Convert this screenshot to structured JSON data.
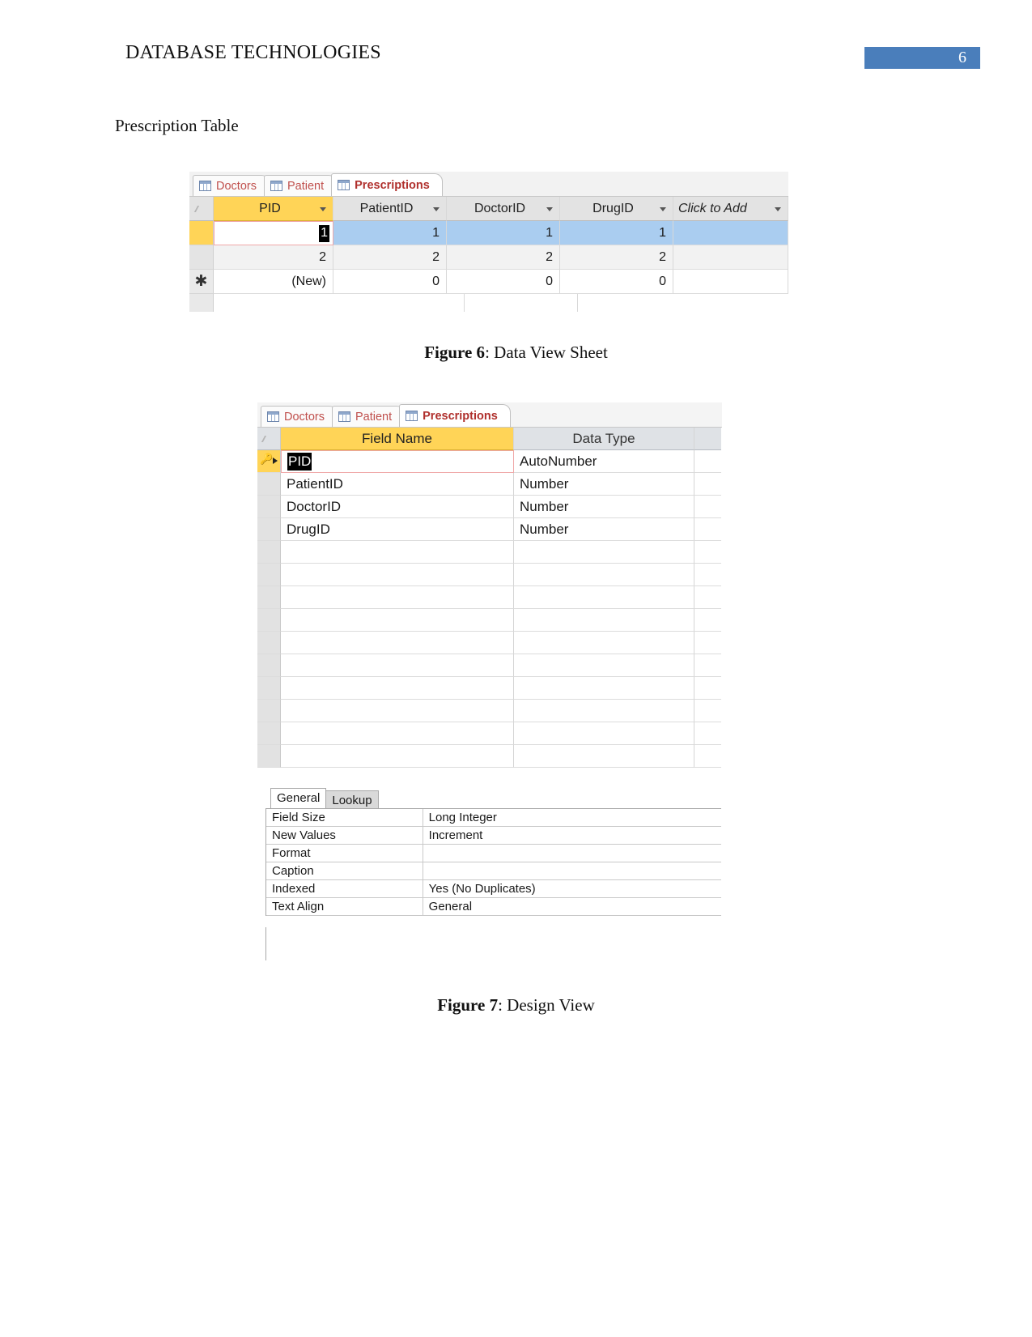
{
  "document": {
    "header_title": "DATABASE TECHNOLOGIES",
    "page_number": "6",
    "page_badge_color": "#4a7ebb",
    "section_text": "Prescription Table"
  },
  "figure6": {
    "caption_label": "Figure 6",
    "caption_text": ": Data View Sheet",
    "tabs": [
      {
        "label": "Doctors",
        "icon": "table-icon",
        "active": false
      },
      {
        "label": "Patient",
        "icon": "table-icon",
        "active": false
      },
      {
        "label": "Prescriptions",
        "icon": "table-icon",
        "active": true
      }
    ],
    "columns": [
      "PID",
      "PatientID",
      "DoctorID",
      "DrugID",
      "Click to Add"
    ],
    "rows": [
      {
        "pid": "1",
        "patient_id": "1",
        "doctor_id": "1",
        "drug_id": "1",
        "state": "selected-editing"
      },
      {
        "pid": "2",
        "patient_id": "2",
        "doctor_id": "2",
        "drug_id": "2",
        "state": "normal"
      },
      {
        "pid": "(New)",
        "patient_id": "0",
        "doctor_id": "0",
        "drug_id": "0",
        "state": "new-record"
      }
    ],
    "new_record_marker": "✱",
    "selected_header": "PID",
    "editing_cell_value": "1"
  },
  "figure7": {
    "caption_label": "Figure 7",
    "caption_text": ": Design View",
    "tabs": [
      {
        "label": "Doctors",
        "icon": "table-icon",
        "active": false
      },
      {
        "label": "Patient",
        "icon": "table-icon",
        "active": false
      },
      {
        "label": "Prescriptions",
        "icon": "table-icon",
        "active": true
      }
    ],
    "columns": [
      "Field Name",
      "Data Type"
    ],
    "fields": [
      {
        "name": "PID",
        "type": "AutoNumber",
        "primary_key": true
      },
      {
        "name": "PatientID",
        "type": "Number",
        "primary_key": false
      },
      {
        "name": "DoctorID",
        "type": "Number",
        "primary_key": false
      },
      {
        "name": "DrugID",
        "type": "Number",
        "primary_key": false
      }
    ],
    "empty_row_count": 10,
    "primary_key_icon": "key-icon",
    "row_cursor_icon": "arrow-right-icon",
    "selected_field_name": "PID"
  },
  "field_properties": {
    "tabs": [
      {
        "label": "General",
        "active": true
      },
      {
        "label": "Lookup",
        "active": false
      }
    ],
    "rows": [
      {
        "key": "Field Size",
        "value": "Long Integer"
      },
      {
        "key": "New Values",
        "value": "Increment"
      },
      {
        "key": "Format",
        "value": ""
      },
      {
        "key": "Caption",
        "value": ""
      },
      {
        "key": "Indexed",
        "value": "Yes (No Duplicates)"
      },
      {
        "key": "Text Align",
        "value": "General"
      }
    ]
  }
}
